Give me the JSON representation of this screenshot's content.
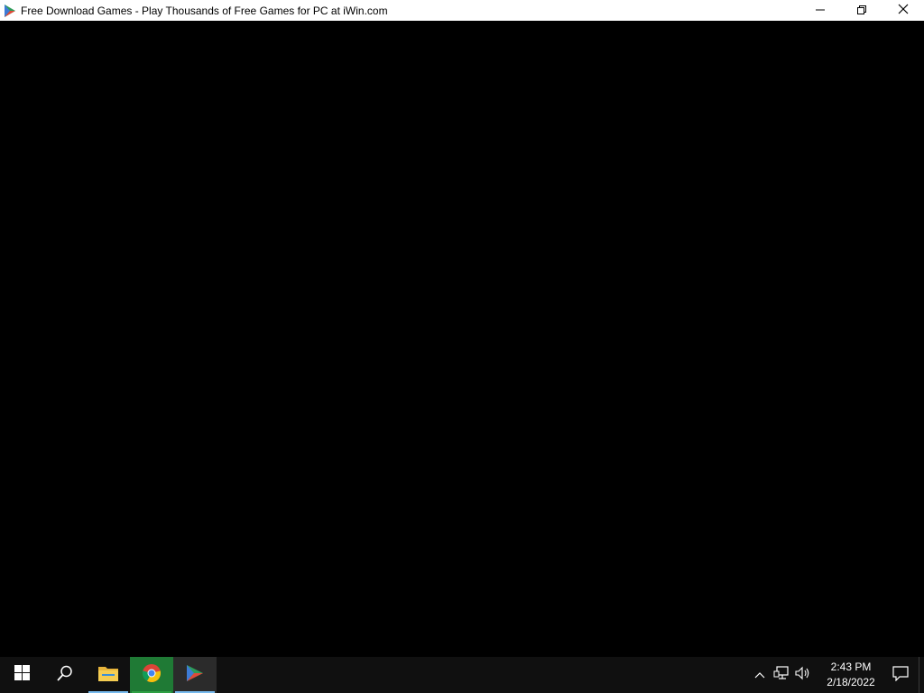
{
  "window": {
    "title": "Free Download Games - Play Thousands of Free Games for PC at iWin.com",
    "app_icon": "iwin-play-icon",
    "controls": [
      "minimize-icon",
      "restore-icon",
      "close-icon"
    ]
  },
  "taskbar": {
    "buttons": [
      {
        "name": "start",
        "icon": "windows-logo-icon"
      },
      {
        "name": "search",
        "icon": "search-icon"
      },
      {
        "name": "file-explorer",
        "icon": "folder-icon"
      },
      {
        "name": "chrome",
        "icon": "chrome-icon"
      },
      {
        "name": "iwin",
        "icon": "iwin-play-icon"
      }
    ],
    "tray": {
      "icons": [
        "chevron-up-icon",
        "network-icon",
        "volume-icon"
      ],
      "time": "2:43 PM",
      "date": "2/18/2022"
    },
    "colors": {
      "explorer_indicator": "#76b9ed",
      "chrome_indicator": "#2ea043",
      "iwin_indicator": "#76b9ed"
    }
  }
}
